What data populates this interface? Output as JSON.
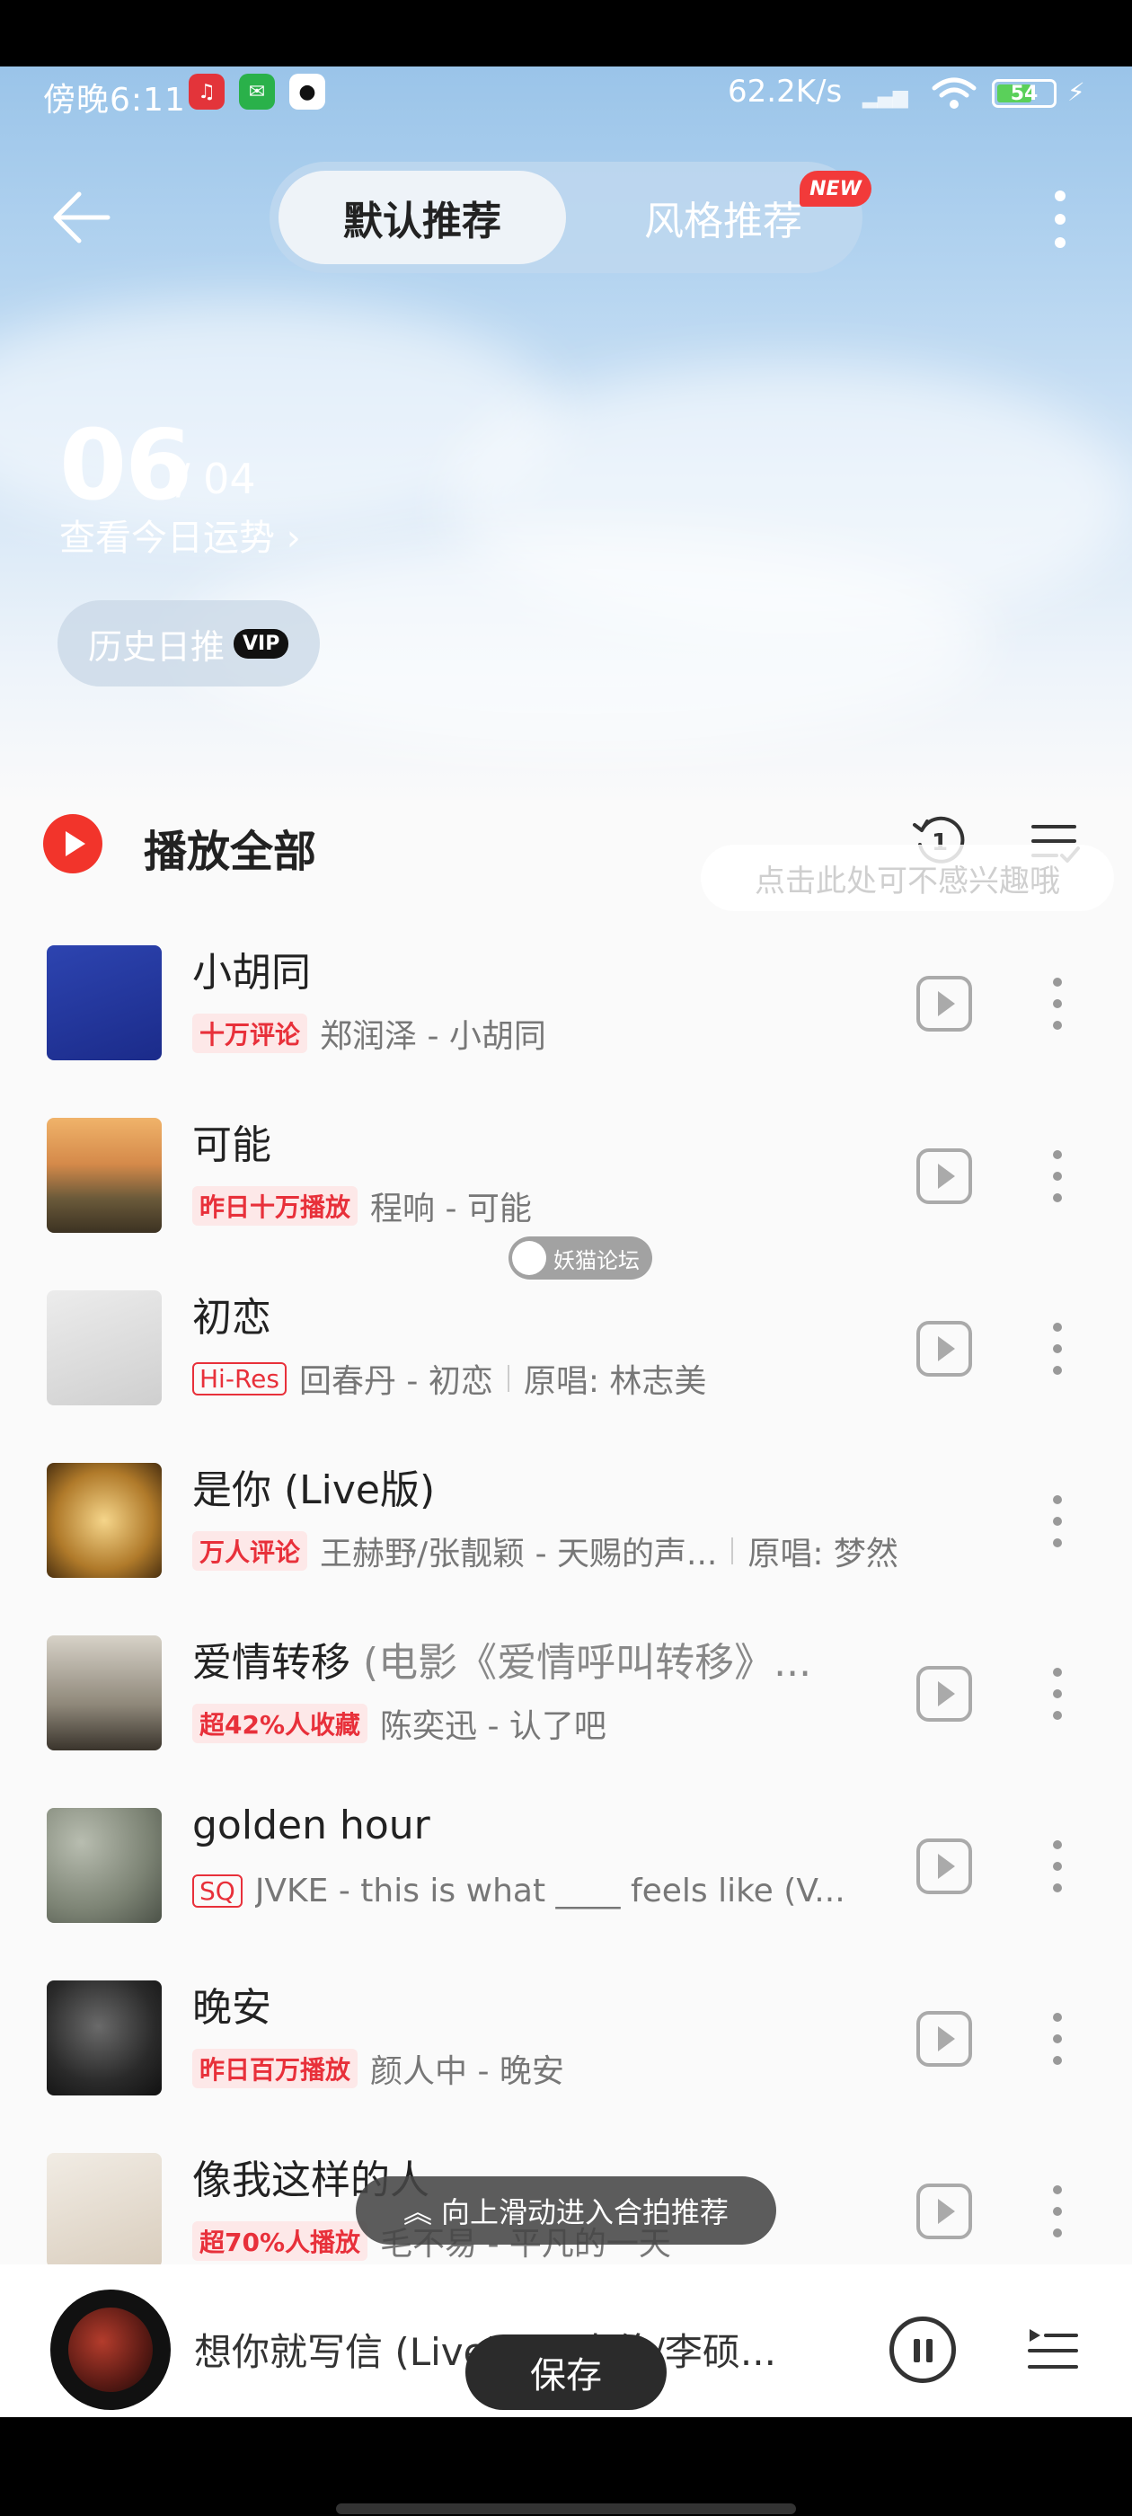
{
  "status_bar": {
    "time": "傍晚6:11",
    "network_speed": "62.2K/s",
    "battery": "54",
    "apps": [
      "netease-music-icon",
      "wechat-icon",
      "qq-icon"
    ]
  },
  "header": {
    "tab_default": "默认推荐",
    "tab_style": "风格推荐",
    "new_badge": "NEW"
  },
  "date": {
    "day": "06",
    "month": "/ 04",
    "fortune_link": "查看今日运势 ›"
  },
  "history": {
    "label": "历史日推",
    "vip": "VIP"
  },
  "list_header": {
    "play_all": "播放全部",
    "replay_count": "1",
    "tooltip": "点击此处可不感兴趣哦"
  },
  "songs": [
    {
      "title": "小胡同",
      "subtitle": "",
      "tag": "十万评论",
      "tag_style": "fill",
      "artist": "郑润泽 - 小胡同",
      "extra": "",
      "has_play": true
    },
    {
      "title": "可能",
      "subtitle": "",
      "tag": "昨日十万播放",
      "tag_style": "fill",
      "artist": "程响 - 可能",
      "extra": "",
      "has_play": true
    },
    {
      "title": "初恋",
      "subtitle": "",
      "tag": "Hi-Res",
      "tag_style": "outline",
      "artist": "回春丹 - 初恋",
      "extra": "原唱: 林志美",
      "has_play": true
    },
    {
      "title": "是你 (Live版)",
      "subtitle": "",
      "tag": "万人评论",
      "tag_style": "fill",
      "artist": "王赫野/张靓颖 - 天赐的声...",
      "extra": "原唱: 梦然",
      "has_play": false
    },
    {
      "title": "爱情转移",
      "subtitle": "(电影《爱情呼叫转移》...",
      "tag": "超42%人收藏",
      "tag_style": "fill",
      "artist": "陈奕迅 - 认了吧",
      "extra": "",
      "has_play": true
    },
    {
      "title": "golden hour",
      "subtitle": "",
      "tag": "SQ",
      "tag_style": "outline",
      "artist": "JVKE - this is what ____ feels like (V...",
      "extra": "",
      "has_play": true
    },
    {
      "title": "晚安",
      "subtitle": "",
      "tag": "昨日百万播放",
      "tag_style": "fill",
      "artist": "颜人中 - 晚安",
      "extra": "",
      "has_play": true
    },
    {
      "title": "像我这样的人",
      "subtitle": "",
      "tag": "超70%人播放",
      "tag_style": "fill",
      "artist": "毛不易 - 平凡的一天",
      "extra": "",
      "has_play": true
    }
  ],
  "swipe_hint": "向上滑动进入合拍推荐",
  "watermark": "妖猫论坛",
  "player": {
    "now_playing": "想你就写信 (Live) - 周杰伦/李硕..."
  },
  "save_button": "保存",
  "colors": {
    "accent_red": "#f2342b",
    "tag_red": "#e8303a",
    "hero_blue": "#9ac4e9"
  }
}
